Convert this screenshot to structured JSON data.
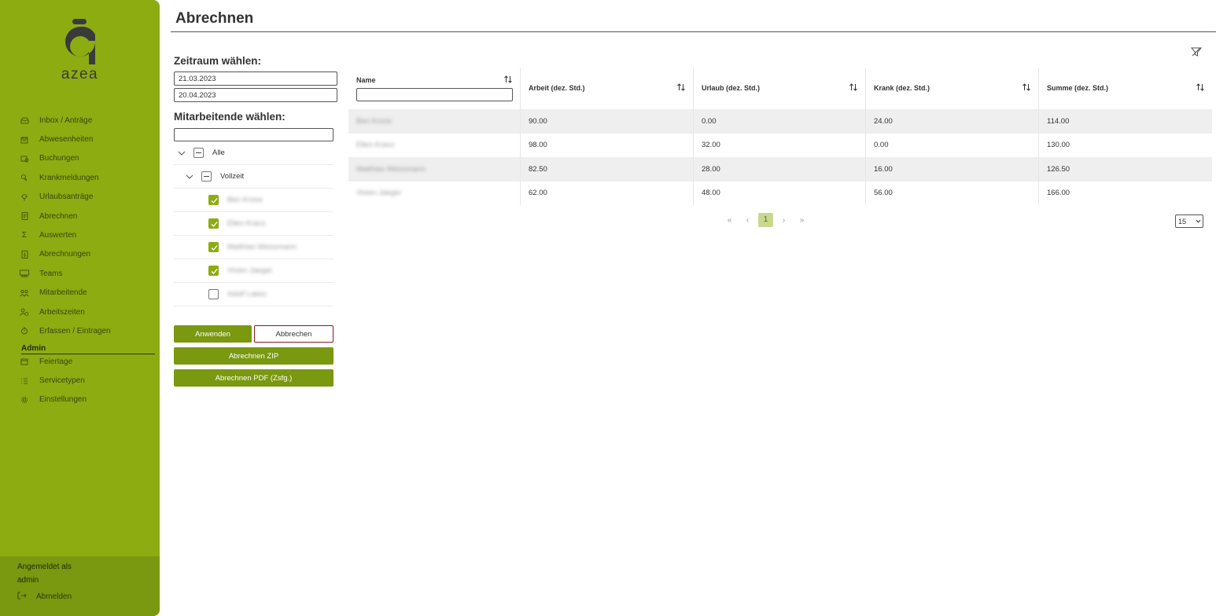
{
  "app": {
    "logo_text": "azea"
  },
  "nav": {
    "items": [
      {
        "label": "Inbox / Anträge",
        "icon": "inbox-icon"
      },
      {
        "label": "Abwesenheiten",
        "icon": "calendar-icon"
      },
      {
        "label": "Buchungen",
        "icon": "booking-icon"
      },
      {
        "label": "Krankmeldungen",
        "icon": "sick-icon"
      },
      {
        "label": "Urlaubsanträge",
        "icon": "vacation-icon"
      },
      {
        "label": "Abrechnen",
        "icon": "document-icon"
      },
      {
        "label": "Auswerten",
        "icon": "sigma-icon"
      },
      {
        "label": "Abrechnungen",
        "icon": "invoice-icon"
      },
      {
        "label": "Teams",
        "icon": "teams-icon"
      },
      {
        "label": "Mitarbeitende",
        "icon": "people-icon"
      },
      {
        "label": "Arbeitszeiten",
        "icon": "user-clock-icon"
      },
      {
        "label": "Erfassen / Eintragen",
        "icon": "stopwatch-icon"
      }
    ],
    "admin_label": "Admin",
    "admin_items": [
      {
        "label": "Feiertage",
        "icon": "holiday-icon"
      },
      {
        "label": "Servicetypen",
        "icon": "list-icon"
      },
      {
        "label": "Einstellungen",
        "icon": "gear-icon"
      }
    ]
  },
  "user": {
    "logged_in_label": "Angemeldet als",
    "username": "admin",
    "logout_label": "Abmelden"
  },
  "page": {
    "title": "Abrechnen"
  },
  "filter": {
    "period_label": "Zeitraum wählen:",
    "date_from": "21.03.2023",
    "date_to": "20.04.2023",
    "employees_label": "Mitarbeitende wählen:",
    "search_value": "",
    "tree": {
      "all_label": "Alle",
      "group_label": "Vollzeit",
      "employees": [
        {
          "name": "Ben Krone",
          "checked": true
        },
        {
          "name": "Ellen Kranz",
          "checked": true
        },
        {
          "name": "Matthias Weissmann",
          "checked": true
        },
        {
          "name": "Vivien Jaeger",
          "checked": true
        },
        {
          "name": "Adolf Lakes",
          "checked": false
        }
      ]
    },
    "apply_label": "Anwenden",
    "cancel_label": "Abbrechen",
    "zip_label": "Abrechnen ZIP",
    "pdf_label": "Abrechnen PDF (Zsfg.)"
  },
  "table": {
    "columns": [
      "Name",
      "Arbeit (dez. Std.)",
      "Urlaub (dez. Std.)",
      "Krank (dez. Std.)",
      "Summe (dez. Std.)"
    ],
    "name_filter_value": "",
    "rows": [
      [
        "Ben Krone",
        "90.00",
        "0.00",
        "24.00",
        "114.00"
      ],
      [
        "Ellen Kranz",
        "98.00",
        "32.00",
        "0.00",
        "130.00"
      ],
      [
        "Matthias Weissmann",
        "82.50",
        "28.00",
        "16.00",
        "126.50"
      ],
      [
        "Vivien Jaeger",
        "62.00",
        "48.00",
        "56.00",
        "166.00"
      ]
    ]
  },
  "pager": {
    "first": "«",
    "prev": "‹",
    "current": "1",
    "next": "›",
    "last": "»",
    "page_size": "15"
  },
  "colors": {
    "sidebar": "#8cac12",
    "button": "#7a9810",
    "cancel_border": "#8b1a1a"
  }
}
